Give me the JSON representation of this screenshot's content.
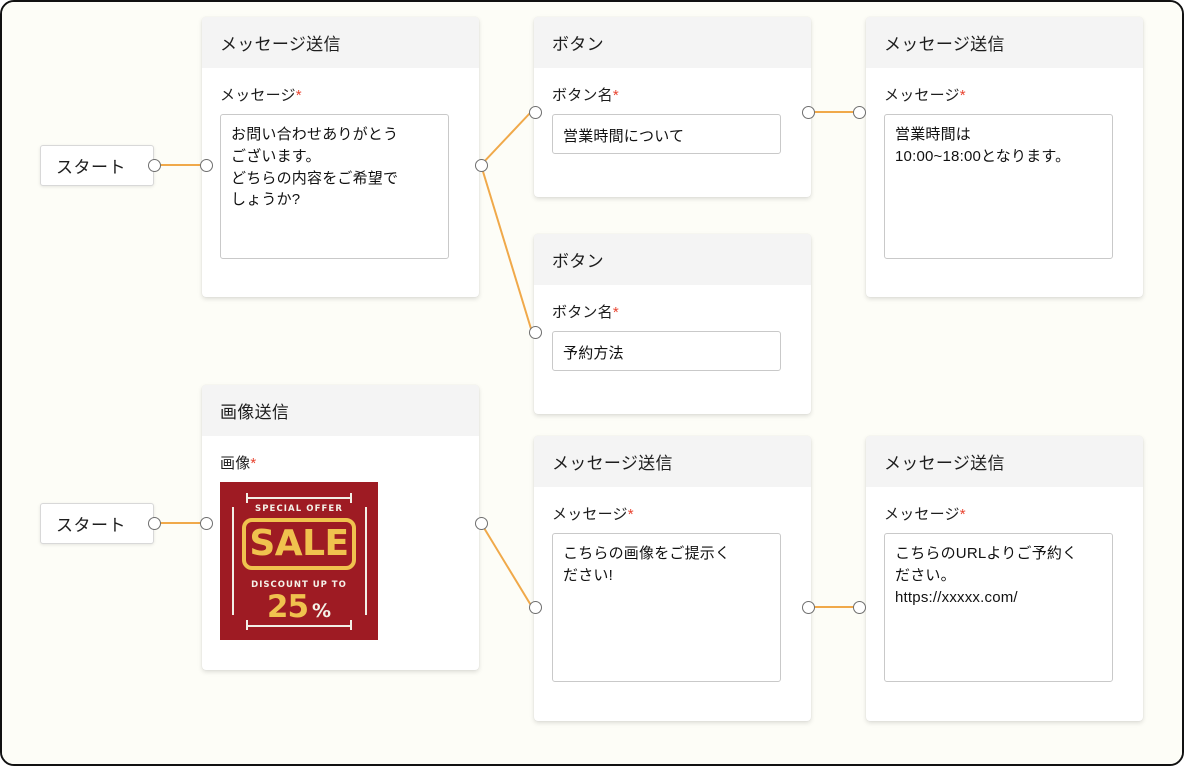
{
  "canvas": {
    "background_color": "#fdfdf7",
    "frame_color": "#111111",
    "edge_color": "#f0a94a",
    "port_border_color": "#6f6f6f",
    "required_mark_color": "#e8432f",
    "header_background": "#f4f4f4"
  },
  "labels": {
    "required_asterisk": "*"
  },
  "start_nodes": [
    {
      "label": "スタート"
    },
    {
      "label": "スタート"
    }
  ],
  "nodes": [
    {
      "id": "msg-welcome",
      "type": "message",
      "header": "メッセージ送信",
      "field_label": "メッセージ",
      "value": "お問い合わせありがとう\nございます。\nどちらの内容をご希望で\nしょうか?"
    },
    {
      "id": "button-hours",
      "type": "button",
      "header": "ボタン",
      "field_label": "ボタン名",
      "value": "営業時間について"
    },
    {
      "id": "msg-hours",
      "type": "message",
      "header": "メッセージ送信",
      "field_label": "メッセージ",
      "value": "営業時間は\n10:00~18:00となります。"
    },
    {
      "id": "button-reserve",
      "type": "button",
      "header": "ボタン",
      "field_label": "ボタン名",
      "value": "予約方法"
    },
    {
      "id": "img-sale",
      "type": "image",
      "header": "画像送信",
      "field_label": "画像",
      "image": {
        "alt": "sale-coupon-image",
        "offer_text": "SPECIAL OFFER",
        "sale_text": "SALE",
        "discount_text": "DISCOUNT UP TO",
        "percent_number": "25",
        "percent_symbol": "%",
        "background_color": "#9e1b23",
        "accent_color": "#f0c24e",
        "text_color": "#f4f1e8"
      }
    },
    {
      "id": "msg-show-image",
      "type": "message",
      "header": "メッセージ送信",
      "field_label": "メッセージ",
      "value": "こちらの画像をご提示く\nださい!"
    },
    {
      "id": "msg-reserve-url",
      "type": "message",
      "header": "メッセージ送信",
      "field_label": "メッセージ",
      "value": "こちらのURLよりご予約く\nださい。\nhttps://xxxxx.com/"
    }
  ]
}
